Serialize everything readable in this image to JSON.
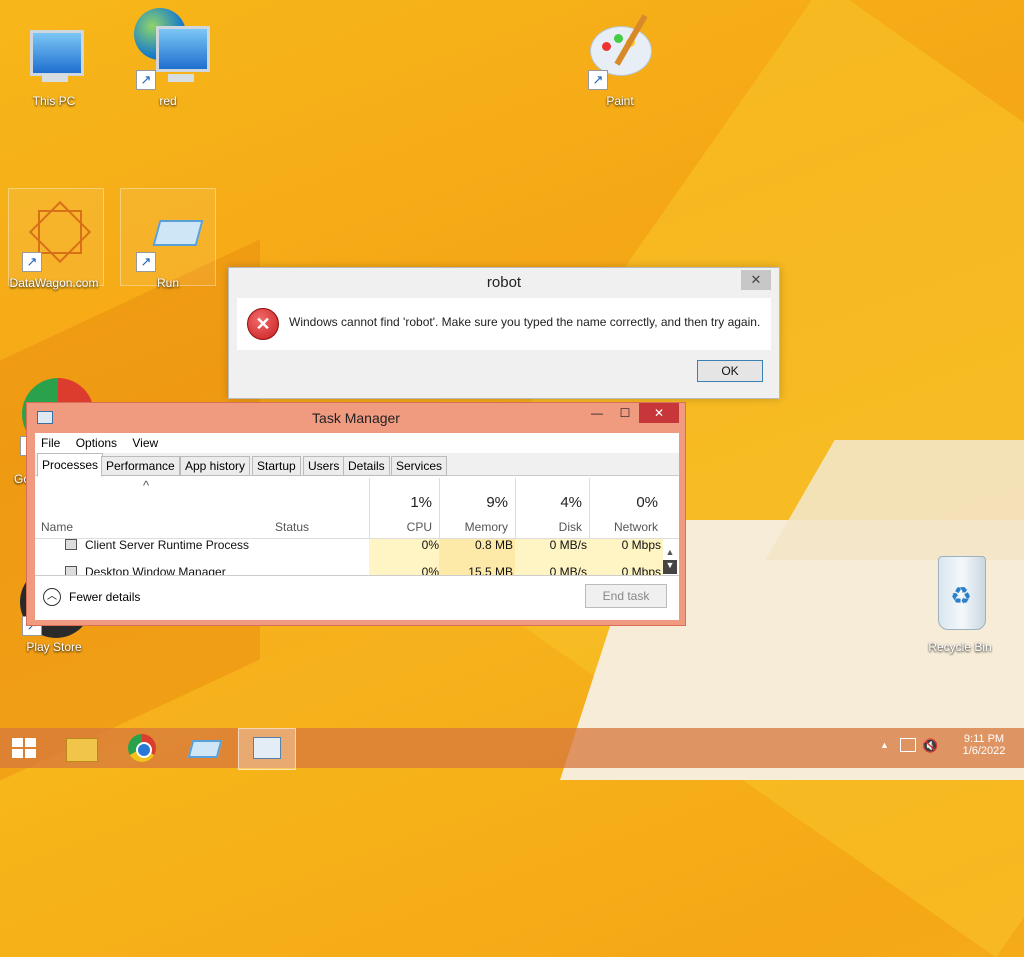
{
  "desktop": {
    "icons": [
      {
        "label": "This PC"
      },
      {
        "label": "red"
      },
      {
        "label": "Paint"
      },
      {
        "label": "DataWagon.com"
      },
      {
        "label": "Run"
      },
      {
        "label": "Go"
      },
      {
        "label": "Play Store"
      },
      {
        "label": "Recycle Bin"
      }
    ]
  },
  "dialog": {
    "title": "robot",
    "close_glyph": "✕",
    "message": "Windows cannot find 'robot'. Make sure you typed the name correctly, and then try again.",
    "ok_label": "OK",
    "icon": "error-icon"
  },
  "task_manager": {
    "title": "Task Manager",
    "menu": [
      "File",
      "Options",
      "View"
    ],
    "tabs": [
      "Processes",
      "Performance",
      "App history",
      "Startup",
      "Users",
      "Details",
      "Services"
    ],
    "active_tab": "Processes",
    "columns": {
      "name": "Name",
      "status": "Status",
      "cpu": {
        "label": "CPU",
        "pct": "1%"
      },
      "memory": {
        "label": "Memory",
        "pct": "9%"
      },
      "disk": {
        "label": "Disk",
        "pct": "4%"
      },
      "network": {
        "label": "Network",
        "pct": "0%"
      }
    },
    "rows": [
      {
        "name": "Client Server Runtime Process",
        "cpu": "0%",
        "memory": "0.8 MB",
        "disk": "0 MB/s",
        "network": "0 Mbps"
      },
      {
        "name": "Desktop Window Manager",
        "cpu": "0%",
        "memory": "15.5 MB",
        "disk": "0 MB/s",
        "network": "0 Mbps"
      }
    ],
    "fewer_details": "Fewer details",
    "end_task": "End task",
    "sort_glyph": "^",
    "minimize_glyph": "—",
    "maximize_glyph": "☐",
    "close_glyph": "✕"
  },
  "taskbar": {
    "items": [
      "start-button",
      "file-explorer",
      "chrome",
      "run",
      "task-manager"
    ],
    "active_item": "task-manager",
    "time": "9:11 PM",
    "date": "1/6/2022"
  },
  "colors": {
    "desktop_bg": "#f5a716",
    "tm_frame": "#f09a80",
    "tm_close": "#c7373a",
    "highlight_col": "#fff4c4"
  }
}
